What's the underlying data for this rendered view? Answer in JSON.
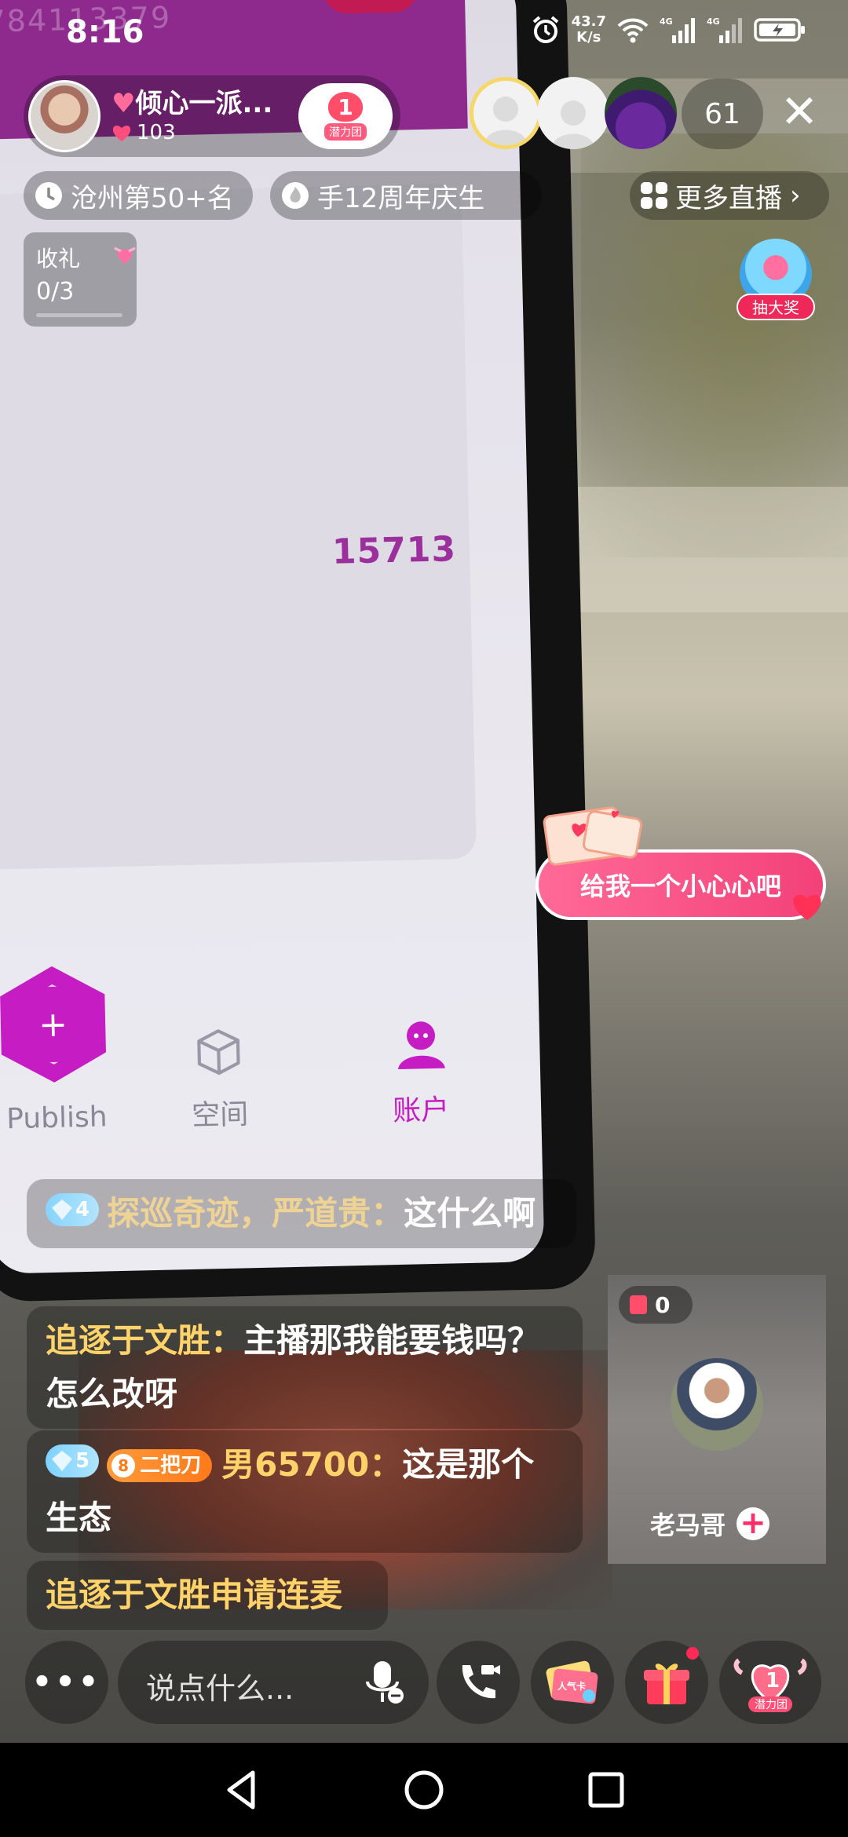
{
  "status_bar": {
    "time": "8:16",
    "net_speed_value": "43.7",
    "net_speed_unit": "K/s",
    "signal_1": "4G",
    "signal_2": "4G"
  },
  "video_content": {
    "faded_number": "784113379",
    "phone_number": "15713",
    "phone_tabs": {
      "publish": "Publish",
      "space": "空间",
      "account": "账户"
    }
  },
  "streamer": {
    "name": "倾心一派...",
    "likes": "103",
    "fan_club_level": "1",
    "fan_club_label": "潜力团"
  },
  "viewers": {
    "count": "61"
  },
  "info_row": {
    "rank": "沧州第50+名",
    "event": "手12周年庆生",
    "more_live": "更多直播"
  },
  "gift_task": {
    "label": "收礼",
    "progress_text": "0/3",
    "progress": 0.0
  },
  "lottery": {
    "label": "抽大奖"
  },
  "heart_cta": {
    "label": "给我一个小心心吧"
  },
  "chat": [
    {
      "level": "4",
      "user": "探巡奇迹，严道贵",
      "text": "这什么啊"
    },
    {
      "user": "追逐于文胜",
      "text": "主播那我能要钱吗？怎么改呀"
    },
    {
      "level": "5",
      "fan_level": "8",
      "fan_name": "二把刀",
      "user": "男65700",
      "text": "这是那个生态"
    },
    {
      "user": "追逐于文胜",
      "text": "申请连麦"
    }
  ],
  "chat_separator": "：",
  "co_host": {
    "gift_count": "0",
    "name": "老马哥"
  },
  "bottom_bar": {
    "comment_placeholder": "说点什么...",
    "card_label": "人气卡",
    "fan_club_level": "1",
    "fan_club_label": "潜力团"
  },
  "colors": {
    "accent_pink": "#f3417a",
    "username_gold": "#ffd36a",
    "phone_purple": "#c51cc4"
  }
}
